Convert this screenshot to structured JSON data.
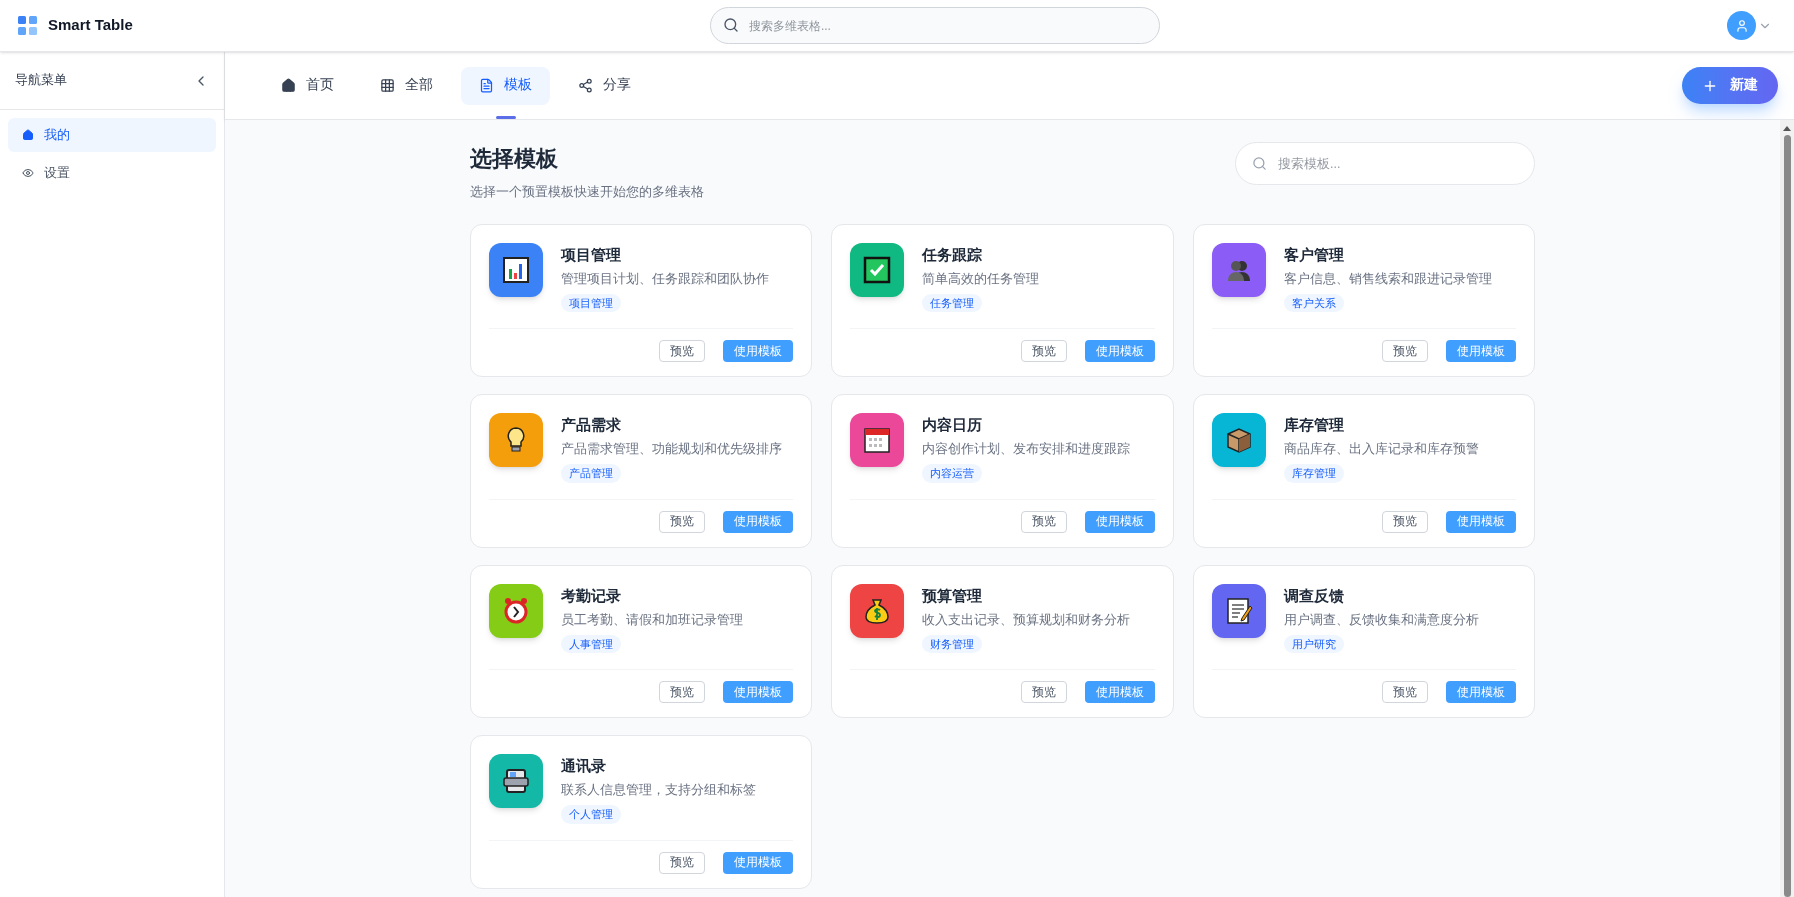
{
  "app": {
    "name": "Smart Table"
  },
  "search": {
    "placeholder": "搜索多维表格..."
  },
  "sidebar": {
    "title": "导航菜单",
    "items": [
      {
        "label": "我的",
        "kind": "home",
        "selected": true
      },
      {
        "label": "设置",
        "kind": "eye",
        "selected": false
      }
    ]
  },
  "tabs": [
    {
      "label": "首页",
      "kind": "home",
      "selected": false
    },
    {
      "label": "全部",
      "kind": "grid",
      "selected": false
    },
    {
      "label": "模板",
      "kind": "doc",
      "selected": true
    },
    {
      "label": "分享",
      "kind": "share",
      "selected": false
    }
  ],
  "new_button": {
    "label": "新建"
  },
  "page": {
    "title": "选择模板",
    "subtitle": "选择一个预置模板快速开始您的多维表格",
    "search_placeholder": "搜索模板..."
  },
  "templates": [
    {
      "title": "项目管理",
      "description": "管理项目计划、任务跟踪和团队协作",
      "tag": "项目管理",
      "kind": "chart",
      "color": "#3b82f6",
      "preview": "预览",
      "use": "使用模板"
    },
    {
      "title": "任务跟踪",
      "description": "简单高效的任务管理",
      "tag": "任务管理",
      "kind": "check",
      "color": "#10b981",
      "preview": "预览",
      "use": "使用模板"
    },
    {
      "title": "客户管理",
      "description": "客户信息、销售线索和跟进记录管理",
      "tag": "客户关系",
      "kind": "people",
      "color": "#8b5cf6",
      "preview": "预览",
      "use": "使用模板"
    },
    {
      "title": "产品需求",
      "description": "产品需求管理、功能规划和优先级排序",
      "tag": "产品管理",
      "kind": "bulb",
      "color": "#f59e0b",
      "preview": "预览",
      "use": "使用模板"
    },
    {
      "title": "内容日历",
      "description": "内容创作计划、发布安排和进度跟踪",
      "tag": "内容运营",
      "kind": "calendar",
      "color": "#ec4899",
      "preview": "预览",
      "use": "使用模板"
    },
    {
      "title": "库存管理",
      "description": "商品库存、出入库记录和库存预警",
      "tag": "库存管理",
      "kind": "box",
      "color": "#06b6d4",
      "preview": "预览",
      "use": "使用模板"
    },
    {
      "title": "考勤记录",
      "description": "员工考勤、请假和加班记录管理",
      "tag": "人事管理",
      "kind": "clock",
      "color": "#84cc16",
      "preview": "预览",
      "use": "使用模板"
    },
    {
      "title": "预算管理",
      "description": "收入支出记录、预算规划和财务分析",
      "tag": "财务管理",
      "kind": "money",
      "color": "#ef4444",
      "preview": "预览",
      "use": "使用模板"
    },
    {
      "title": "调查反馈",
      "description": "用户调查、反馈收集和满意度分析",
      "tag": "用户研究",
      "kind": "memo",
      "color": "#6366f1",
      "preview": "预览",
      "use": "使用模板"
    },
    {
      "title": "通讯录",
      "description": "联系人信息管理，支持分组和标签",
      "tag": "个人管理",
      "kind": "contacts",
      "color": "#14b8a6",
      "preview": "预览",
      "use": "使用模板"
    }
  ]
}
